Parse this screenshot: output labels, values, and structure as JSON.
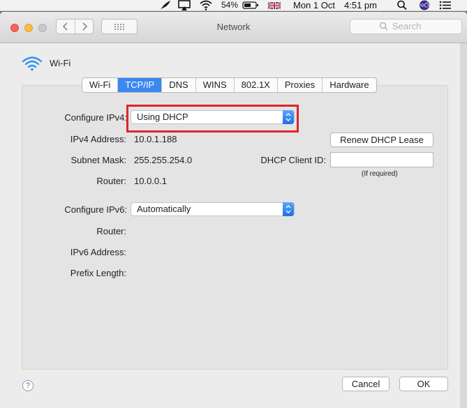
{
  "menubar": {
    "battery": "54%",
    "date": "Mon 1 Oct",
    "time": "4:51 pm"
  },
  "window": {
    "title": "Network",
    "search_placeholder": "Search"
  },
  "service": {
    "name": "Wi-Fi"
  },
  "tabs": [
    {
      "label": "Wi-Fi",
      "active": false
    },
    {
      "label": "TCP/IP",
      "active": true
    },
    {
      "label": "DNS",
      "active": false
    },
    {
      "label": "WINS",
      "active": false
    },
    {
      "label": "802.1X",
      "active": false
    },
    {
      "label": "Proxies",
      "active": false
    },
    {
      "label": "Hardware",
      "active": false
    }
  ],
  "ipv4": {
    "configure_label": "Configure IPv4:",
    "configure_value": "Using DHCP",
    "address_label": "IPv4 Address:",
    "address_value": "10.0.1.188",
    "subnet_label": "Subnet Mask:",
    "subnet_value": "255.255.254.0",
    "router_label": "Router:",
    "router_value": "10.0.0.1",
    "renew_button": "Renew DHCP Lease",
    "client_id_label": "DHCP Client ID:",
    "client_id_value": "",
    "client_id_hint": "(If required)"
  },
  "ipv6": {
    "configure_label": "Configure IPv6:",
    "configure_value": "Automatically",
    "router_label": "Router:",
    "address_label": "IPv6 Address:",
    "prefix_label": "Prefix Length:"
  },
  "footer": {
    "help": "?",
    "cancel": "Cancel",
    "ok": "OK"
  },
  "colors": {
    "accent": "#3a88f0",
    "highlight": "#e0242b"
  }
}
